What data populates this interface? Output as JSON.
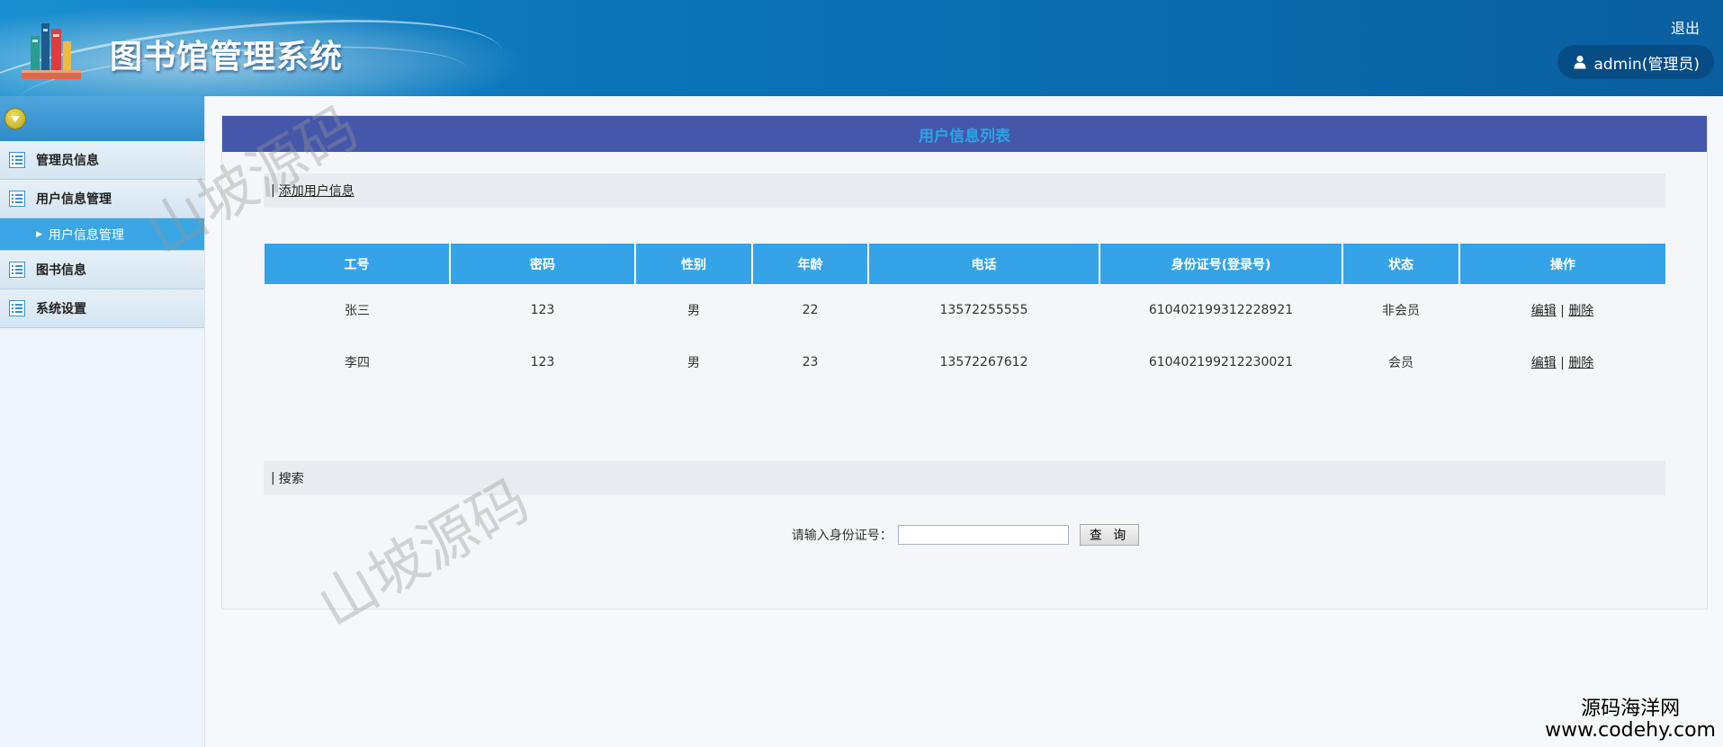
{
  "header": {
    "app_title": "图书馆管理系统",
    "logout_label": "退出",
    "user_label": "admin(管理员)"
  },
  "sidebar": {
    "items": [
      {
        "label": "管理员信息"
      },
      {
        "label": "用户信息管理"
      },
      {
        "label": "用户信息管理",
        "sub": true,
        "active": true
      },
      {
        "label": "图书信息"
      },
      {
        "label": "系统设置"
      }
    ]
  },
  "main": {
    "panel_title": "用户信息列表",
    "add_section": {
      "separator": "|",
      "link_label": "添加用户信息"
    },
    "table": {
      "columns": [
        "工号",
        "密码",
        "性别",
        "年龄",
        "电话",
        "身份证号(登录号)",
        "状态",
        "操作"
      ],
      "rows": [
        {
          "id": "张三",
          "password": "123",
          "gender": "男",
          "age": "22",
          "phone": "13572255555",
          "id_card": "610402199312228921",
          "status": "非会员",
          "edit": "编辑",
          "sep": "|",
          "delete": "删除"
        },
        {
          "id": "李四",
          "password": "123",
          "gender": "男",
          "age": "23",
          "phone": "13572267612",
          "id_card": "610402199212230021",
          "status": "会员",
          "edit": "编辑",
          "sep": "|",
          "delete": "删除"
        }
      ]
    },
    "search_section": {
      "separator": "|",
      "title": "搜索"
    },
    "search": {
      "label": "请输入身份证号：",
      "input_value": "",
      "button_label": "查 询"
    }
  },
  "watermarks": {
    "text": "山坡源码",
    "corner_line1": "源码海洋网",
    "corner_line2": "www.codehy.com"
  },
  "colors": {
    "header_blue": "#0b74b8",
    "panel_title_bg": "#4557ab",
    "table_header_bg": "#35a3e8",
    "active_nav_bg": "#3aa7e4"
  }
}
